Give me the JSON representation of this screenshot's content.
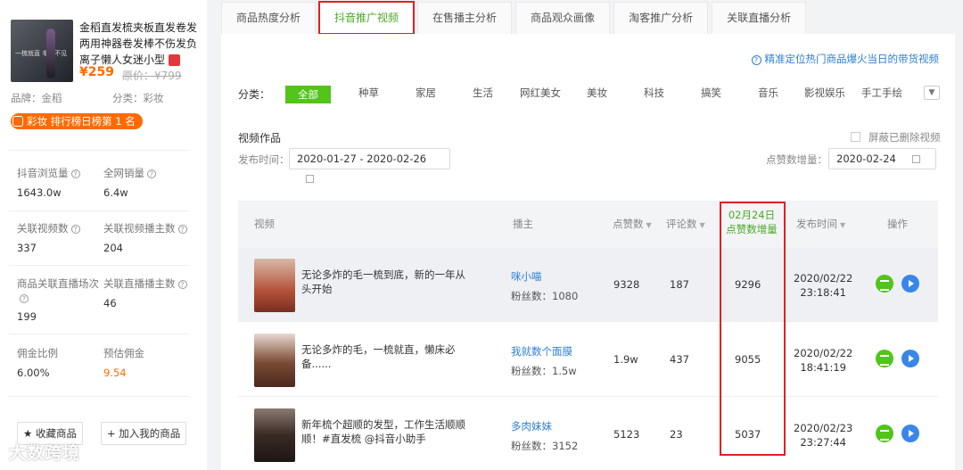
{
  "product": {
    "title": "金稻直发梳夹板直发卷发两用神器卷发棒不伤发负离子懒人女迷小型",
    "price": "¥259",
    "original_price": "原价：¥799",
    "brand": "品牌：金稻",
    "category": "分类：彩妆",
    "rank": "彩妆 排行榜日榜第 1 名",
    "image_text": "一梳就直 毛躁不见"
  },
  "stats": [
    {
      "label": "抖音浏览量",
      "value": "1643.0w"
    },
    {
      "label": "全网销量",
      "value": "6.4w"
    },
    {
      "label": "关联视频数",
      "value": "337"
    },
    {
      "label": "关联视频播主数",
      "value": "204"
    },
    {
      "label": "商品关联直播场次",
      "value": "199"
    },
    {
      "label": "关联直播播主数",
      "value": "46"
    },
    {
      "label": "佣金比例",
      "value": "6.00%"
    },
    {
      "label": "预估佣金",
      "value": "9.54"
    }
  ],
  "buttons": {
    "favorite": "★ 收藏商品",
    "add": "+ 加入我的商品"
  },
  "watermark": "大数跨境",
  "tabs": [
    "商品热度分析",
    "抖音推广视频",
    "在售播主分析",
    "商品观众画像",
    "淘客推广分析",
    "关联直播分析"
  ],
  "hint": "精准定位热门商品爆火当日的带货视频",
  "category_label": "分类：",
  "categories": [
    "全部",
    "种草",
    "家居",
    "生活",
    "网红美女",
    "美妆",
    "科技",
    "搞笑",
    "音乐",
    "影视娱乐",
    "手工手绘"
  ],
  "filters": {
    "video_label": "视频作品",
    "publish_label": "发布时间：",
    "date_range": "2020-01-27 - 2020-02-26",
    "hide_deleted": "屏蔽已删除视频",
    "increase_label": "点赞数增量：",
    "increase_date": "2020-02-24"
  },
  "table": {
    "headers": {
      "video": "视频",
      "anchor": "播主",
      "likes": "点赞数",
      "comments": "评论数",
      "inc_date": "02月24日",
      "inc_label": "点赞数增量",
      "time": "发布时间",
      "action": "操作"
    },
    "rows": [
      {
        "desc": "无论多炸的毛一梳到底，新的一年从头开始",
        "anchor": "咪小喵",
        "fans": "粉丝数：1080",
        "likes": "9328",
        "comments": "187",
        "increase": "9296",
        "date": "2020/02/22",
        "time": "23:18:41",
        "thumb": "#b4523a"
      },
      {
        "desc": "无论多炸的毛，一梳就直，懒床必备......",
        "anchor": "我就数个面膜",
        "fans": "粉丝数：1.5w",
        "likes": "1.9w",
        "comments": "437",
        "increase": "9055",
        "date": "2020/02/22",
        "time": "18:41:19",
        "thumb": "#7a4a32"
      },
      {
        "desc": "新年梳个超顺的发型，工作生活顺顺顺！#直发梳 @抖音小助手",
        "anchor": "多肉妹妹",
        "fans": "粉丝数：3152",
        "likes": "5123",
        "comments": "23",
        "increase": "5037",
        "date": "2020/02/23",
        "time": "23:27:44",
        "thumb": "#3a2a24"
      }
    ]
  }
}
